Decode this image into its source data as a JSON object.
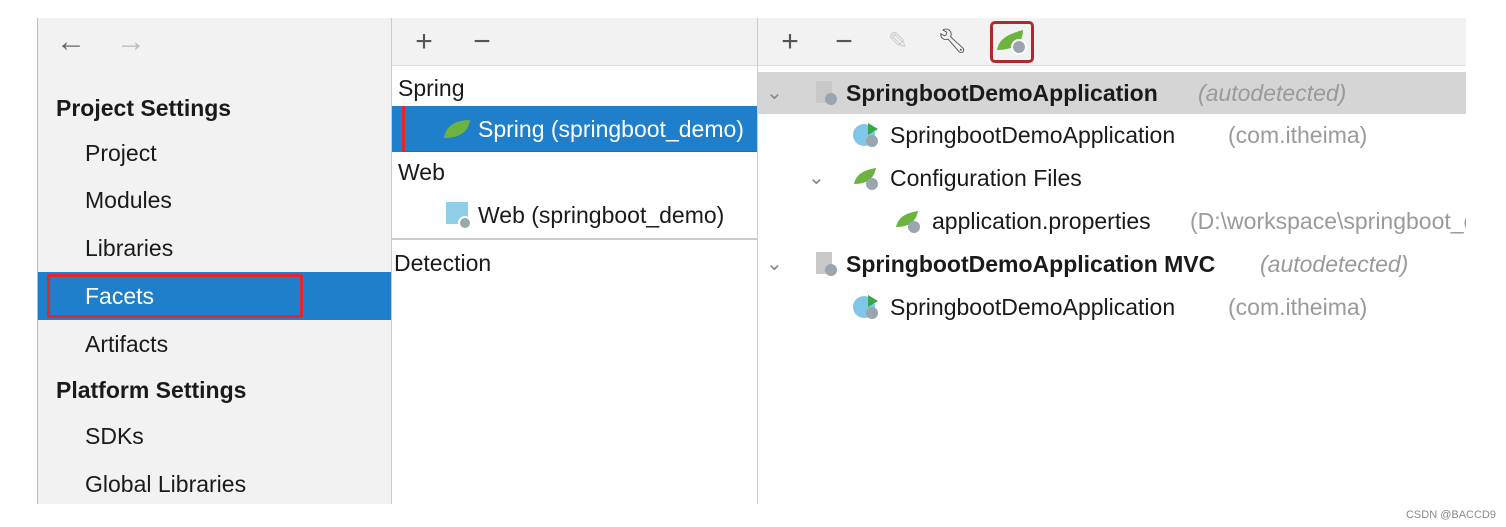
{
  "nav": {
    "back_icon": "arrow-left-icon",
    "forward_icon": "arrow-right-icon"
  },
  "sidebar": {
    "project_settings": "Project Settings",
    "project_items": [
      {
        "label": "Project"
      },
      {
        "label": "Modules"
      },
      {
        "label": "Libraries"
      },
      {
        "label": "Facets",
        "selected": true
      },
      {
        "label": "Artifacts"
      }
    ],
    "platform_settings": "Platform Settings",
    "platform_items": [
      {
        "label": "SDKs"
      },
      {
        "label": "Global Libraries"
      }
    ]
  },
  "facets": {
    "toolbar": {
      "add": "+",
      "remove": "−"
    },
    "groups": [
      {
        "label": "Spring",
        "items": [
          {
            "label": "Spring (springboot_demo)",
            "selected": true
          }
        ]
      },
      {
        "label": "Web",
        "items": [
          {
            "label": "Web (springboot_demo)"
          }
        ]
      }
    ],
    "detection": "Detection"
  },
  "detail": {
    "toolbar": {
      "add": "+",
      "remove": "−",
      "edit_icon": "pencil-icon",
      "wrench_icon": "wrench-icon",
      "spring_icon": "spring-boot-icon"
    },
    "tree": [
      {
        "name": "SpringbootDemoApplication",
        "suffix": "(autodetected)"
      },
      {
        "name": "SpringbootDemoApplication",
        "suffix": "(com.itheima)"
      },
      {
        "name": "Configuration Files"
      },
      {
        "name": "application.properties",
        "suffix": "(D:\\workspace\\springboot_demo"
      },
      {
        "name": "SpringbootDemoApplication MVC",
        "suffix": "(autodetected)"
      },
      {
        "name": "SpringbootDemoApplication",
        "suffix": "(com.itheima)"
      }
    ]
  },
  "colors": {
    "selection": "#1f7fcb",
    "highlight": "#e3262e",
    "spring": "#6db33f"
  },
  "watermark": "CSDN @BACCD9"
}
